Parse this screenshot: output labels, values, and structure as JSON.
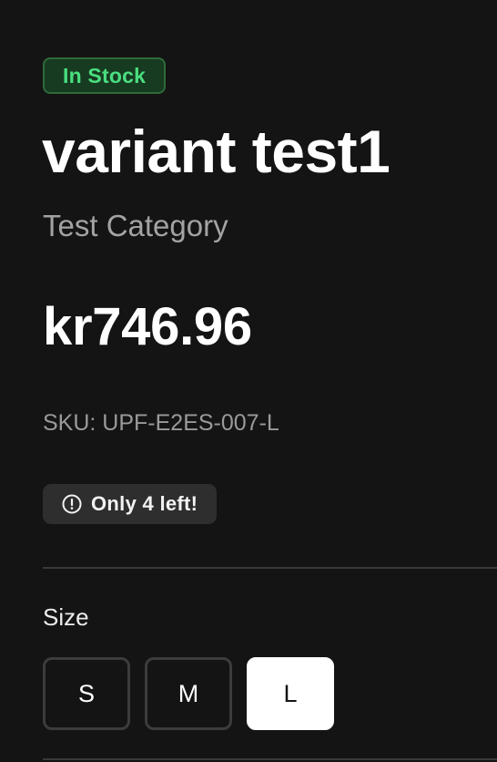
{
  "product": {
    "stock_badge": "In Stock",
    "title": "variant test1",
    "category": "Test Category",
    "price": "kr746.96",
    "sku": "SKU: UPF-E2ES-007-L",
    "low_stock_notice": "Only 4 left!",
    "low_stock_icon": "alert-circle-icon"
  },
  "size_selector": {
    "label": "Size",
    "options": [
      "S",
      "M",
      "L"
    ],
    "selected": "L"
  },
  "colors": {
    "background": "#141414",
    "in_stock_text": "#4ade80",
    "in_stock_bg": "#173b20",
    "muted_text": "#a3a3a3",
    "selected_size_bg": "#ffffff"
  }
}
